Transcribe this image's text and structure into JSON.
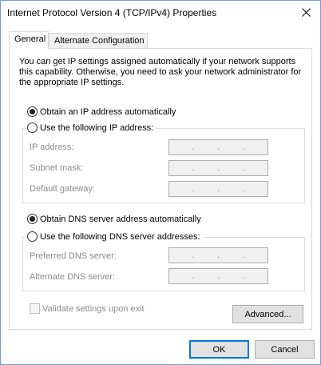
{
  "window": {
    "title": "Internet Protocol Version 4 (TCP/IPv4) Properties",
    "close_icon": "close-icon"
  },
  "tabs": [
    {
      "label": "General",
      "selected": true
    },
    {
      "label": "Alternate Configuration",
      "selected": false
    }
  ],
  "description": "You can get IP settings assigned automatically if your network supports this capability. Otherwise, you need to ask your network administrator for the appropriate IP settings.",
  "ip_options": {
    "auto_label": "Obtain an IP address automatically",
    "auto_selected": true,
    "manual_label": "Use the following IP address:",
    "manual_selected": false,
    "fields": [
      {
        "label": "IP address:",
        "value": ". . ."
      },
      {
        "label": "Subnet mask:",
        "value": ". . ."
      },
      {
        "label": "Default gateway:",
        "value": ". . ."
      }
    ]
  },
  "dns_options": {
    "auto_label": "Obtain DNS server address automatically",
    "auto_selected": true,
    "manual_label": "Use the following DNS server addresses:",
    "manual_selected": false,
    "fields": [
      {
        "label": "Preferred DNS server:",
        "value": ". . ."
      },
      {
        "label": "Alternate DNS server:",
        "value": ". . ."
      }
    ]
  },
  "validate": {
    "label": "Validate settings upon exit",
    "checked": false,
    "enabled": false
  },
  "buttons": {
    "advanced": "Advanced...",
    "ok": "OK",
    "cancel": "Cancel"
  },
  "colors": {
    "accent": "#0078d7",
    "disabled_text": "#8c8c8c"
  }
}
